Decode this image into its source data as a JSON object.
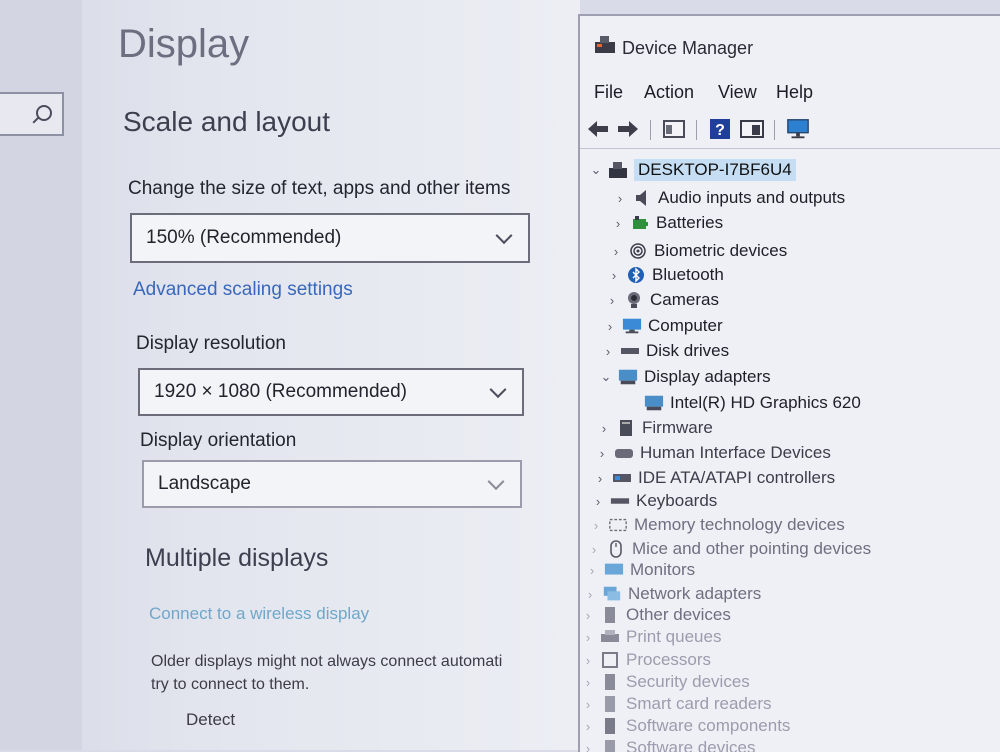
{
  "settings": {
    "page_title": "Display",
    "section_scale": "Scale and layout",
    "scale_label": "Change the size of text, apps and other items",
    "scale_value": "150% (Recommended)",
    "advanced_scaling_link": "Advanced scaling settings",
    "resolution_label": "Display resolution",
    "resolution_value": "1920 × 1080 (Recommended)",
    "orientation_label": "Display orientation",
    "orientation_value": "Landscape",
    "section_multiple": "Multiple displays",
    "wireless_link": "Connect to a wireless display",
    "older_displays_text": "Older displays might not always connect automati try to connect to them.",
    "older_displays_line1": "Older displays might not always connect automati",
    "older_displays_line2": "try to connect to them.",
    "detect_button": "Detect"
  },
  "device_manager": {
    "title": "Device Manager",
    "menu": [
      "File",
      "Action",
      "View",
      "Help"
    ],
    "toolbar_icons": [
      "back-arrow-icon",
      "forward-arrow-icon",
      "properties-icon",
      "help-icon",
      "show-hide-icon",
      "monitor-icon"
    ],
    "root": "DESKTOP-I7BF6U4",
    "items": [
      {
        "label": "Audio inputs and outputs",
        "icon": "speaker-icon",
        "expanded": false
      },
      {
        "label": "Batteries",
        "icon": "battery-icon",
        "expanded": false
      },
      {
        "label": "Biometric devices",
        "icon": "fingerprint-icon",
        "expanded": false
      },
      {
        "label": "Bluetooth",
        "icon": "bluetooth-icon",
        "expanded": false
      },
      {
        "label": "Cameras",
        "icon": "camera-icon",
        "expanded": false
      },
      {
        "label": "Computer",
        "icon": "computer-icon",
        "expanded": false
      },
      {
        "label": "Disk drives",
        "icon": "disk-icon",
        "expanded": false
      },
      {
        "label": "Display adapters",
        "icon": "display-adapter-icon",
        "expanded": true
      },
      {
        "label": "Intel(R) HD Graphics 620",
        "icon": "display-adapter-icon",
        "child": true
      },
      {
        "label": "Firmware",
        "icon": "firmware-icon",
        "expanded": false
      },
      {
        "label": "Human Interface Devices",
        "icon": "hid-icon",
        "expanded": false
      },
      {
        "label": "IDE ATA/ATAPI controllers",
        "icon": "ide-icon",
        "expanded": false
      },
      {
        "label": "Keyboards",
        "icon": "keyboard-icon",
        "expanded": false
      },
      {
        "label": "Memory technology devices",
        "icon": "memory-icon",
        "expanded": false
      },
      {
        "label": "Mice and other pointing devices",
        "icon": "mouse-icon",
        "expanded": false
      },
      {
        "label": "Monitors",
        "icon": "monitor-icon",
        "expanded": false
      },
      {
        "label": "Network adapters",
        "icon": "network-icon",
        "expanded": false
      },
      {
        "label": "Other devices",
        "icon": "other-devices-icon",
        "expanded": false
      },
      {
        "label": "Print queues",
        "icon": "printer-icon",
        "expanded": false
      },
      {
        "label": "Processors",
        "icon": "processor-icon",
        "expanded": false
      },
      {
        "label": "Security devices",
        "icon": "security-icon",
        "expanded": false
      },
      {
        "label": "Smart card readers",
        "icon": "smart-card-icon",
        "expanded": false
      },
      {
        "label": "Software components",
        "icon": "software-components-icon",
        "expanded": false
      },
      {
        "label": "Software devices",
        "icon": "software-devices-icon",
        "expanded": false
      }
    ]
  },
  "colors": {
    "link": "#3868bb",
    "selection": "#c6def4",
    "accent_blue": "#2d7fd0"
  }
}
